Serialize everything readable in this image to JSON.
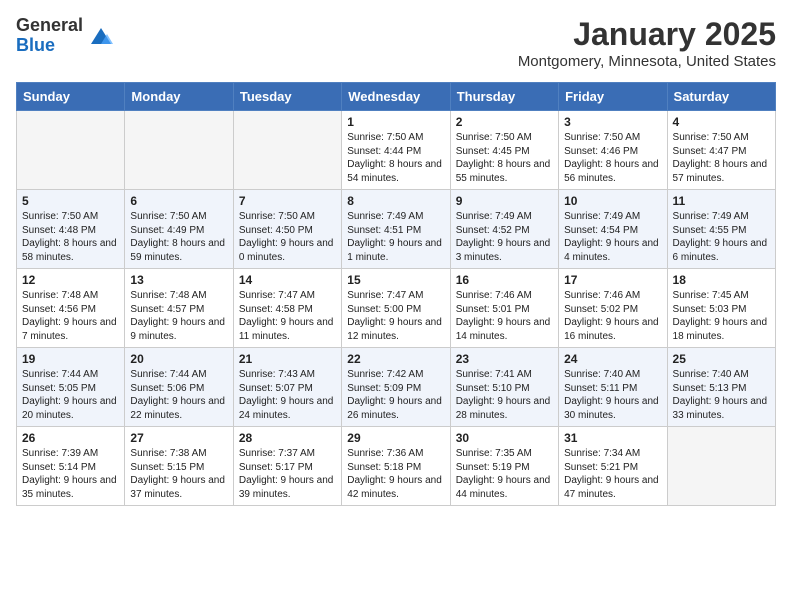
{
  "header": {
    "logo_general": "General",
    "logo_blue": "Blue",
    "month_title": "January 2025",
    "location": "Montgomery, Minnesota, United States"
  },
  "weekdays": [
    "Sunday",
    "Monday",
    "Tuesday",
    "Wednesday",
    "Thursday",
    "Friday",
    "Saturday"
  ],
  "weeks": [
    [
      {
        "day": "",
        "empty": true
      },
      {
        "day": "",
        "empty": true
      },
      {
        "day": "",
        "empty": true
      },
      {
        "day": "1",
        "sunrise": "7:50 AM",
        "sunset": "4:44 PM",
        "daylight": "8 hours and 54 minutes."
      },
      {
        "day": "2",
        "sunrise": "7:50 AM",
        "sunset": "4:45 PM",
        "daylight": "8 hours and 55 minutes."
      },
      {
        "day": "3",
        "sunrise": "7:50 AM",
        "sunset": "4:46 PM",
        "daylight": "8 hours and 56 minutes."
      },
      {
        "day": "4",
        "sunrise": "7:50 AM",
        "sunset": "4:47 PM",
        "daylight": "8 hours and 57 minutes."
      }
    ],
    [
      {
        "day": "5",
        "sunrise": "7:50 AM",
        "sunset": "4:48 PM",
        "daylight": "8 hours and 58 minutes."
      },
      {
        "day": "6",
        "sunrise": "7:50 AM",
        "sunset": "4:49 PM",
        "daylight": "8 hours and 59 minutes."
      },
      {
        "day": "7",
        "sunrise": "7:50 AM",
        "sunset": "4:50 PM",
        "daylight": "9 hours and 0 minutes."
      },
      {
        "day": "8",
        "sunrise": "7:49 AM",
        "sunset": "4:51 PM",
        "daylight": "9 hours and 1 minute."
      },
      {
        "day": "9",
        "sunrise": "7:49 AM",
        "sunset": "4:52 PM",
        "daylight": "9 hours and 3 minutes."
      },
      {
        "day": "10",
        "sunrise": "7:49 AM",
        "sunset": "4:54 PM",
        "daylight": "9 hours and 4 minutes."
      },
      {
        "day": "11",
        "sunrise": "7:49 AM",
        "sunset": "4:55 PM",
        "daylight": "9 hours and 6 minutes."
      }
    ],
    [
      {
        "day": "12",
        "sunrise": "7:48 AM",
        "sunset": "4:56 PM",
        "daylight": "9 hours and 7 minutes."
      },
      {
        "day": "13",
        "sunrise": "7:48 AM",
        "sunset": "4:57 PM",
        "daylight": "9 hours and 9 minutes."
      },
      {
        "day": "14",
        "sunrise": "7:47 AM",
        "sunset": "4:58 PM",
        "daylight": "9 hours and 11 minutes."
      },
      {
        "day": "15",
        "sunrise": "7:47 AM",
        "sunset": "5:00 PM",
        "daylight": "9 hours and 12 minutes."
      },
      {
        "day": "16",
        "sunrise": "7:46 AM",
        "sunset": "5:01 PM",
        "daylight": "9 hours and 14 minutes."
      },
      {
        "day": "17",
        "sunrise": "7:46 AM",
        "sunset": "5:02 PM",
        "daylight": "9 hours and 16 minutes."
      },
      {
        "day": "18",
        "sunrise": "7:45 AM",
        "sunset": "5:03 PM",
        "daylight": "9 hours and 18 minutes."
      }
    ],
    [
      {
        "day": "19",
        "sunrise": "7:44 AM",
        "sunset": "5:05 PM",
        "daylight": "9 hours and 20 minutes."
      },
      {
        "day": "20",
        "sunrise": "7:44 AM",
        "sunset": "5:06 PM",
        "daylight": "9 hours and 22 minutes."
      },
      {
        "day": "21",
        "sunrise": "7:43 AM",
        "sunset": "5:07 PM",
        "daylight": "9 hours and 24 minutes."
      },
      {
        "day": "22",
        "sunrise": "7:42 AM",
        "sunset": "5:09 PM",
        "daylight": "9 hours and 26 minutes."
      },
      {
        "day": "23",
        "sunrise": "7:41 AM",
        "sunset": "5:10 PM",
        "daylight": "9 hours and 28 minutes."
      },
      {
        "day": "24",
        "sunrise": "7:40 AM",
        "sunset": "5:11 PM",
        "daylight": "9 hours and 30 minutes."
      },
      {
        "day": "25",
        "sunrise": "7:40 AM",
        "sunset": "5:13 PM",
        "daylight": "9 hours and 33 minutes."
      }
    ],
    [
      {
        "day": "26",
        "sunrise": "7:39 AM",
        "sunset": "5:14 PM",
        "daylight": "9 hours and 35 minutes."
      },
      {
        "day": "27",
        "sunrise": "7:38 AM",
        "sunset": "5:15 PM",
        "daylight": "9 hours and 37 minutes."
      },
      {
        "day": "28",
        "sunrise": "7:37 AM",
        "sunset": "5:17 PM",
        "daylight": "9 hours and 39 minutes."
      },
      {
        "day": "29",
        "sunrise": "7:36 AM",
        "sunset": "5:18 PM",
        "daylight": "9 hours and 42 minutes."
      },
      {
        "day": "30",
        "sunrise": "7:35 AM",
        "sunset": "5:19 PM",
        "daylight": "9 hours and 44 minutes."
      },
      {
        "day": "31",
        "sunrise": "7:34 AM",
        "sunset": "5:21 PM",
        "daylight": "9 hours and 47 minutes."
      },
      {
        "day": "",
        "empty": true
      }
    ]
  ]
}
